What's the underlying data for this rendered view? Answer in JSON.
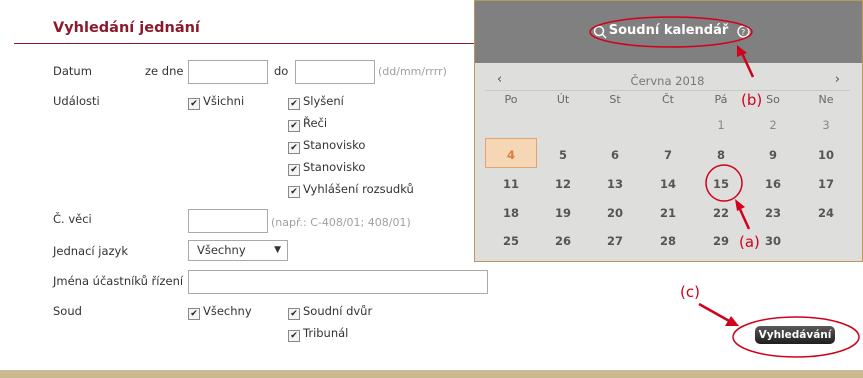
{
  "form": {
    "title": "Vyhledání jednání",
    "date": {
      "label": "Datum",
      "from_label": "ze dne",
      "from_value": "",
      "to_label": "do",
      "to_value": "",
      "hint": "(dd/mm/rrrr)"
    },
    "events": {
      "label": "Události",
      "options": [
        {
          "label": "Všichni",
          "checked": true
        },
        {
          "label": "Slyšení",
          "checked": true
        },
        {
          "label": "Řeči",
          "checked": true
        },
        {
          "label": "Stanovisko",
          "checked": true
        },
        {
          "label": "Stanovisko",
          "checked": true
        },
        {
          "label": "Vyhlášení rozsudků",
          "checked": true
        }
      ]
    },
    "case_number": {
      "label": "Č. věci",
      "value": "",
      "hint": "(např.: C-408/01; 408/01)"
    },
    "language": {
      "label": "Jednací jazyk",
      "selected": "Všechny",
      "arrow": "▼"
    },
    "parties": {
      "label": "Jména účastníků řízení",
      "value": ""
    },
    "court": {
      "label": "Soud",
      "options": [
        {
          "label": "Všechny",
          "checked": true
        },
        {
          "label": "Soudní dvůr",
          "checked": true
        },
        {
          "label": "Tribunál",
          "checked": true
        }
      ]
    },
    "search_button": "Vyhledávání"
  },
  "calendar": {
    "title": "Soudní kalendář",
    "month": "Června 2018",
    "prev": "‹",
    "next": "›",
    "weekdays": [
      "Po",
      "Út",
      "St",
      "Čt",
      "Pá",
      "So",
      "Ne"
    ],
    "weeks": [
      [
        "",
        "",
        "",
        "",
        "1",
        "2",
        "3"
      ],
      [
        "4",
        "5",
        "6",
        "7",
        "8",
        "9",
        "10"
      ],
      [
        "11",
        "12",
        "13",
        "14",
        "15",
        "16",
        "17"
      ],
      [
        "18",
        "19",
        "20",
        "21",
        "22",
        "23",
        "24"
      ],
      [
        "25",
        "26",
        "27",
        "28",
        "29",
        "30",
        ""
      ]
    ],
    "today": "4"
  },
  "annotations": {
    "a": "(a)",
    "b": "(b)",
    "c": "(c)"
  },
  "colors": {
    "title": "#8b1a2b",
    "annotation": "#d0021b",
    "today_bg": "#f6d7b5",
    "header": "#808080"
  }
}
